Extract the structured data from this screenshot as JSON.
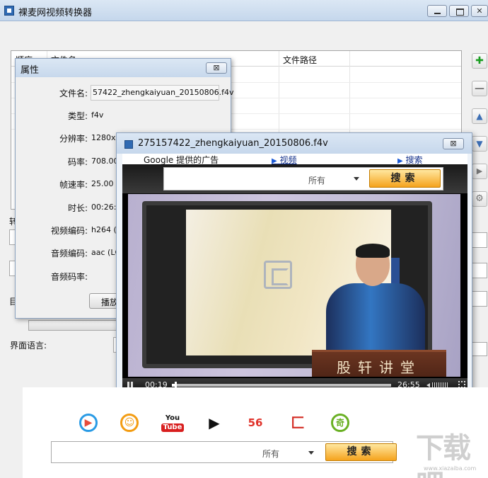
{
  "main_window": {
    "title": "裸麦网视频转换器",
    "table_headers": {
      "order": "顺序",
      "file_name": "文件名",
      "file_path": "文件路径"
    },
    "truncated_labels": {
      "label_1": "转",
      "label_2": "目"
    },
    "language_label": "界面语言:"
  },
  "properties_dialog": {
    "title": "属性",
    "close": "⊠",
    "fields": [
      {
        "label": "文件名:",
        "value": "57422_zhengkaiyuan_20150806.f4v"
      },
      {
        "label": "类型:",
        "value": "f4v"
      },
      {
        "label": "分辨率:",
        "value": "1280x7"
      },
      {
        "label": "码率:",
        "value": "708.00"
      },
      {
        "label": "帧速率:",
        "value": "25.00 f"
      },
      {
        "label": "时长:",
        "value": "00:26:5"
      },
      {
        "label": "视频编码:",
        "value": "h264 (H"
      },
      {
        "label": "音频编码:",
        "value": "aac (LC"
      },
      {
        "label": "音频码率:",
        "value": ""
      }
    ],
    "play_button": "播放"
  },
  "player": {
    "title": "275157422_zhengkaiyuan_20150806.f4v",
    "close": "⊠",
    "ad_text": "Google 提供的广告",
    "link_video": "视频",
    "link_search": "搜索",
    "select_value": "所有",
    "search_button": "搜索",
    "podium_text": "股轩讲堂",
    "current_time": "00:19",
    "total_time": "26:55",
    "progress_fraction": 0.012
  },
  "bottom": {
    "site_icons": [
      "youku-icon",
      "tudou-icon",
      "youtube-icon",
      "iqiyi-pps-icon",
      "56-icon",
      "letv-icon",
      "qiyi-icon"
    ],
    "youtube_top": "You",
    "youtube_bottom": "Tube",
    "site_56": "56",
    "site_qi": "奇",
    "select_value": "所有",
    "search_button": "搜索",
    "watermark": "下载吧",
    "watermark_url": "www.xiazaiba.com"
  }
}
